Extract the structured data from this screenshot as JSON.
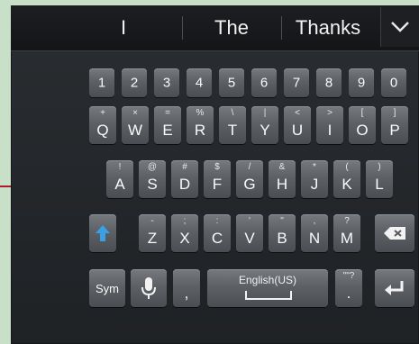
{
  "suggestions": [
    "I",
    "The",
    "Thanks"
  ],
  "number_row": [
    "1",
    "2",
    "3",
    "4",
    "5",
    "6",
    "7",
    "8",
    "9",
    "0"
  ],
  "row_qwerty": [
    {
      "key": "Q",
      "sub": "+"
    },
    {
      "key": "W",
      "sub": "×"
    },
    {
      "key": "E",
      "sub": "="
    },
    {
      "key": "R",
      "sub": "%"
    },
    {
      "key": "T",
      "sub": "\\"
    },
    {
      "key": "Y",
      "sub": "|"
    },
    {
      "key": "U",
      "sub": "<"
    },
    {
      "key": "I",
      "sub": ">"
    },
    {
      "key": "O",
      "sub": "["
    },
    {
      "key": "P",
      "sub": "]"
    }
  ],
  "row_asdf": [
    {
      "key": "A",
      "sub": "!"
    },
    {
      "key": "S",
      "sub": "@"
    },
    {
      "key": "D",
      "sub": "#"
    },
    {
      "key": "F",
      "sub": "$"
    },
    {
      "key": "G",
      "sub": "/"
    },
    {
      "key": "H",
      "sub": "&"
    },
    {
      "key": "J",
      "sub": "*"
    },
    {
      "key": "K",
      "sub": "("
    },
    {
      "key": "L",
      "sub": ")"
    }
  ],
  "row_zxcv": [
    {
      "key": "Z",
      "sub": "-"
    },
    {
      "key": "X",
      "sub": ";"
    },
    {
      "key": "C",
      "sub": ":"
    },
    {
      "key": "V",
      "sub": "'"
    },
    {
      "key": "B",
      "sub": "\""
    },
    {
      "key": "N",
      "sub": ","
    },
    {
      "key": "M",
      "sub": "?"
    }
  ],
  "bottom": {
    "sym_label": "Sym",
    "comma_label": ",",
    "space_label": "English(US)",
    "period_label": ".",
    "period_sub": "\"\"?"
  },
  "icons": {
    "collapse": "chevron-down-icon",
    "shift": "shift-arrow-icon",
    "backspace": "backspace-icon",
    "mic": "microphone-icon",
    "enter": "enter-icon",
    "pointer": "left-arrow-pointer"
  },
  "colors": {
    "frame_bg": "#c7e0c7",
    "keyboard_bg": "#2a2d31",
    "key_face": "#5d6065",
    "shift_blue": "#3aa0e6",
    "pointer_line": "#b0182c"
  }
}
